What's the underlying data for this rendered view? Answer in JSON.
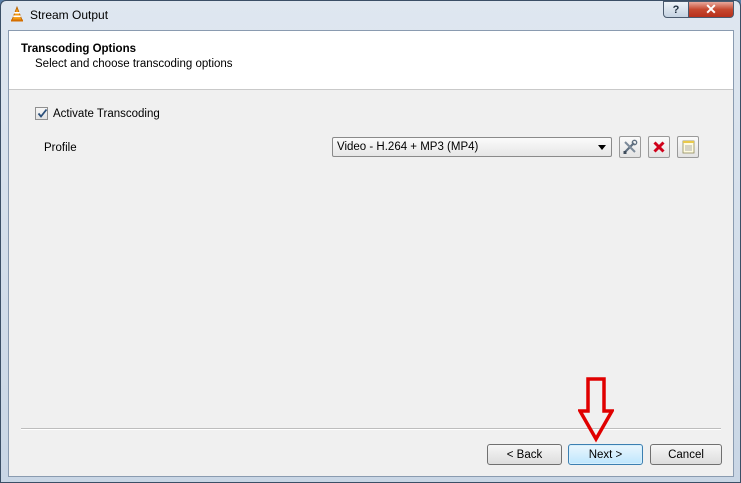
{
  "window": {
    "title": "Stream Output",
    "caption_help": "?",
    "caption_close": "✕"
  },
  "header": {
    "title": "Transcoding Options",
    "subtitle": "Select and choose transcoding options"
  },
  "transcoding": {
    "activate_label": "Activate Transcoding",
    "activate_checked": true,
    "profile_label": "Profile",
    "profile_value": "Video - H.264 + MP3 (MP4)"
  },
  "buttons": {
    "back": "< Back",
    "next": "Next >",
    "cancel": "Cancel"
  },
  "icons": {
    "app": "vlc-cone-icon",
    "edit_profile": "tools-icon",
    "delete_profile": "red-x-icon",
    "new_profile": "notepad-icon",
    "annotation": "red-down-arrow"
  },
  "colors": {
    "accent_red": "#e00000",
    "next_button_border": "#3c7fb1"
  }
}
